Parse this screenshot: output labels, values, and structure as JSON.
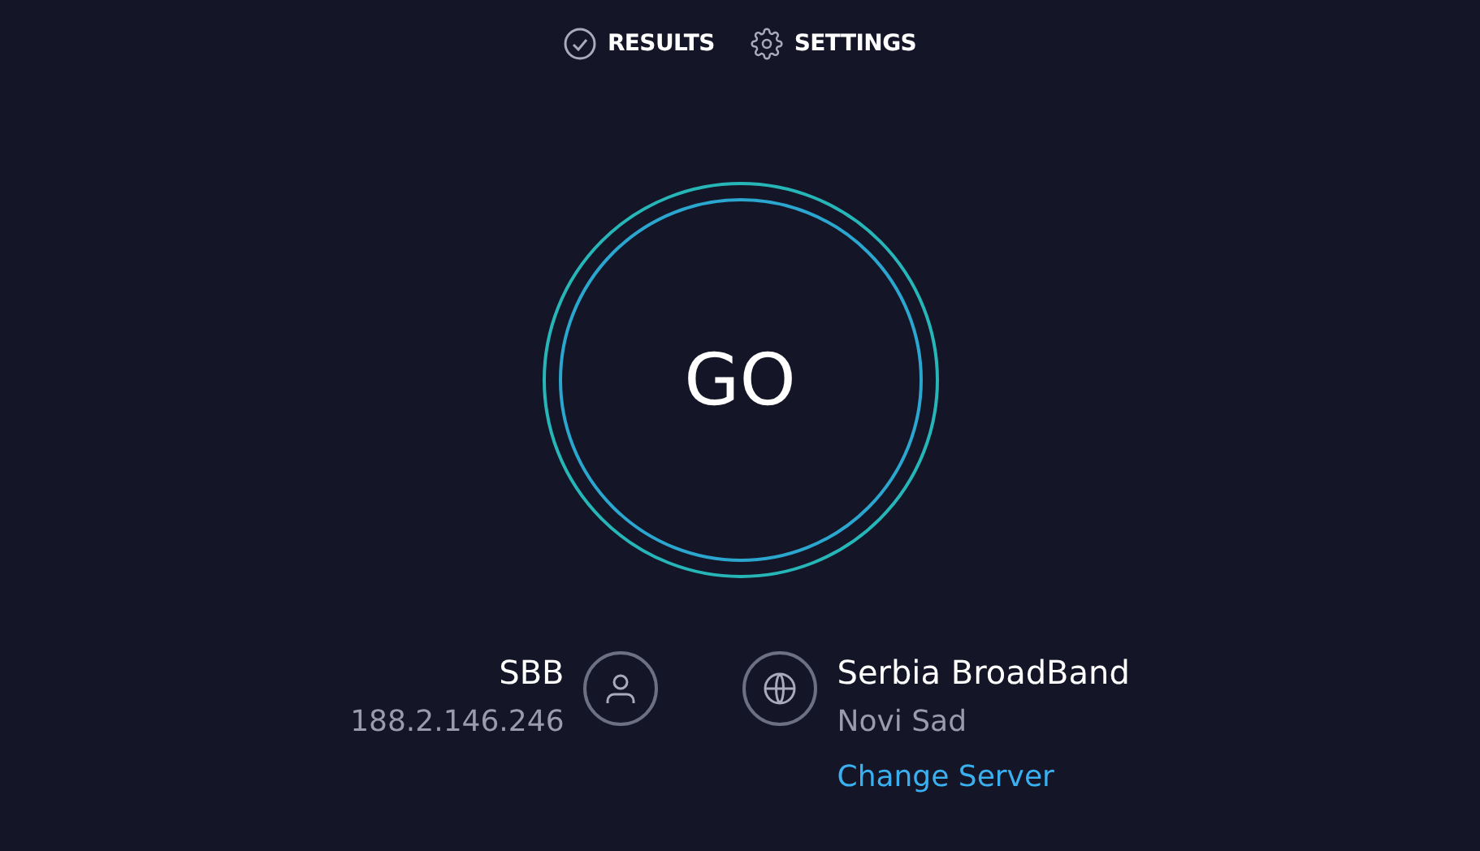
{
  "nav": [
    {
      "kind": "results",
      "label": "RESULTS"
    },
    {
      "kind": "settings",
      "label": "SETTINGS"
    }
  ],
  "go_button": {
    "label": "GO"
  },
  "isp": {
    "name": "SBB",
    "ip": "188.2.146.246"
  },
  "server": {
    "name": "Serbia BroadBand",
    "location": "Novi Sad",
    "change_link": "Change Server"
  }
}
